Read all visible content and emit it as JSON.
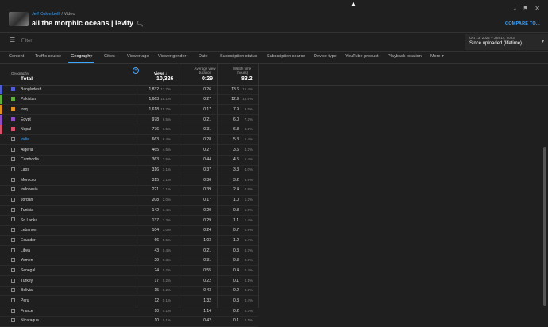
{
  "header": {
    "channel": "Jeff Colombelli",
    "sep": "/",
    "section": "Video",
    "video_title": "all the morphic oceans | levity",
    "compare_label": "COMPARE TO..."
  },
  "filter": {
    "placeholder": "Filter"
  },
  "date": {
    "range": "Oct 13, 2022 – Jan 14, 2023",
    "label": "Since uploaded (lifetime)"
  },
  "tabs": [
    "Content",
    "Traffic source",
    "Geography",
    "Cities",
    "Viewer age",
    "Viewer gender",
    "Date",
    "Subscription status",
    "Subscription source",
    "Device type",
    "YouTube product",
    "Playback location",
    "More"
  ],
  "active_tab": "Geography",
  "columns": {
    "geo": "Geography",
    "views": "Views",
    "avd_1": "Average view",
    "avd_2": "duration",
    "wt_1": "Watch time",
    "wt_2": "(hours)"
  },
  "totals": {
    "label": "Total",
    "views": "10,326",
    "avd": "0:29",
    "watch": "83.2"
  },
  "rows": [
    {
      "country": "Bangladesh",
      "views": "1,832",
      "pct": "17.7%",
      "avd": "0:26",
      "watch": "13.6",
      "wpct": "16.4%",
      "color": "#4f5fd1",
      "checked": true
    },
    {
      "country": "Pakistan",
      "views": "1,663",
      "pct": "16.1%",
      "avd": "0:27",
      "watch": "12.9",
      "wpct": "15.5%",
      "color": "#5fae3b",
      "checked": true
    },
    {
      "country": "Iraq",
      "views": "1,618",
      "pct": "15.7%",
      "avd": "0:17",
      "watch": "7.9",
      "wpct": "9.5%",
      "color": "#e0911f",
      "checked": true
    },
    {
      "country": "Egypt",
      "views": "978",
      "pct": "9.5%",
      "avd": "0:21",
      "watch": "6.0",
      "wpct": "7.2%",
      "color": "#8e4fc2",
      "checked": true
    },
    {
      "country": "Nepal",
      "views": "776",
      "pct": "7.5%",
      "avd": "0:31",
      "watch": "6.8",
      "wpct": "8.2%",
      "color": "#d8506a",
      "checked": true
    },
    {
      "country": "India",
      "views": "663",
      "pct": "6.4%",
      "avd": "0:28",
      "watch": "5.3",
      "wpct": "6.4%",
      "color": "",
      "checked": false
    },
    {
      "country": "Algeria",
      "views": "465",
      "pct": "4.5%",
      "avd": "0:27",
      "watch": "3.5",
      "wpct": "4.2%",
      "color": "",
      "checked": false
    },
    {
      "country": "Cambodia",
      "views": "363",
      "pct": "3.5%",
      "avd": "0:44",
      "watch": "4.5",
      "wpct": "5.4%",
      "color": "",
      "checked": false
    },
    {
      "country": "Laos",
      "views": "316",
      "pct": "3.1%",
      "avd": "0:37",
      "watch": "3.3",
      "wpct": "4.0%",
      "color": "",
      "checked": false
    },
    {
      "country": "Morocco",
      "views": "315",
      "pct": "3.1%",
      "avd": "0:36",
      "watch": "3.2",
      "wpct": "3.9%",
      "color": "",
      "checked": false
    },
    {
      "country": "Indonesia",
      "views": "221",
      "pct": "2.1%",
      "avd": "0:39",
      "watch": "2.4",
      "wpct": "2.9%",
      "color": "",
      "checked": false
    },
    {
      "country": "Jordan",
      "views": "208",
      "pct": "2.0%",
      "avd": "0:17",
      "watch": "1.0",
      "wpct": "1.2%",
      "color": "",
      "checked": false
    },
    {
      "country": "Tunisia",
      "views": "142",
      "pct": "1.4%",
      "avd": "0:20",
      "watch": "0.8",
      "wpct": "1.0%",
      "color": "",
      "checked": false
    },
    {
      "country": "Sri Lanka",
      "views": "137",
      "pct": "1.3%",
      "avd": "0:29",
      "watch": "1.1",
      "wpct": "1.4%",
      "color": "",
      "checked": false
    },
    {
      "country": "Lebanon",
      "views": "104",
      "pct": "1.0%",
      "avd": "0:24",
      "watch": "0.7",
      "wpct": "0.9%",
      "color": "",
      "checked": false
    },
    {
      "country": "Ecuador",
      "views": "66",
      "pct": "0.6%",
      "avd": "1:03",
      "watch": "1.2",
      "wpct": "1.4%",
      "color": "",
      "checked": false
    },
    {
      "country": "Libya",
      "views": "43",
      "pct": "0.4%",
      "avd": "0:21",
      "watch": "0.3",
      "wpct": "0.3%",
      "color": "",
      "checked": false
    },
    {
      "country": "Yemen",
      "views": "29",
      "pct": "0.3%",
      "avd": "0:31",
      "watch": "0.3",
      "wpct": "0.3%",
      "color": "",
      "checked": false
    },
    {
      "country": "Senegal",
      "views": "24",
      "pct": "0.2%",
      "avd": "0:55",
      "watch": "0.4",
      "wpct": "0.4%",
      "color": "",
      "checked": false
    },
    {
      "country": "Turkey",
      "views": "17",
      "pct": "0.2%",
      "avd": "0:22",
      "watch": "0.1",
      "wpct": "0.1%",
      "color": "",
      "checked": false
    },
    {
      "country": "Bolivia",
      "views": "15",
      "pct": "0.2%",
      "avd": "0:43",
      "watch": "0.2",
      "wpct": "0.2%",
      "color": "",
      "checked": false
    },
    {
      "country": "Peru",
      "views": "12",
      "pct": "0.1%",
      "avd": "1:32",
      "watch": "0.3",
      "wpct": "0.4%",
      "color": "",
      "checked": false
    },
    {
      "country": "France",
      "views": "10",
      "pct": "0.1%",
      "avd": "1:14",
      "watch": "0.2",
      "wpct": "0.3%",
      "color": "",
      "checked": false
    },
    {
      "country": "Nicaragua",
      "views": "10",
      "pct": "0.1%",
      "avd": "0:42",
      "watch": "0.1",
      "wpct": "0.1%",
      "color": "",
      "checked": false
    }
  ]
}
